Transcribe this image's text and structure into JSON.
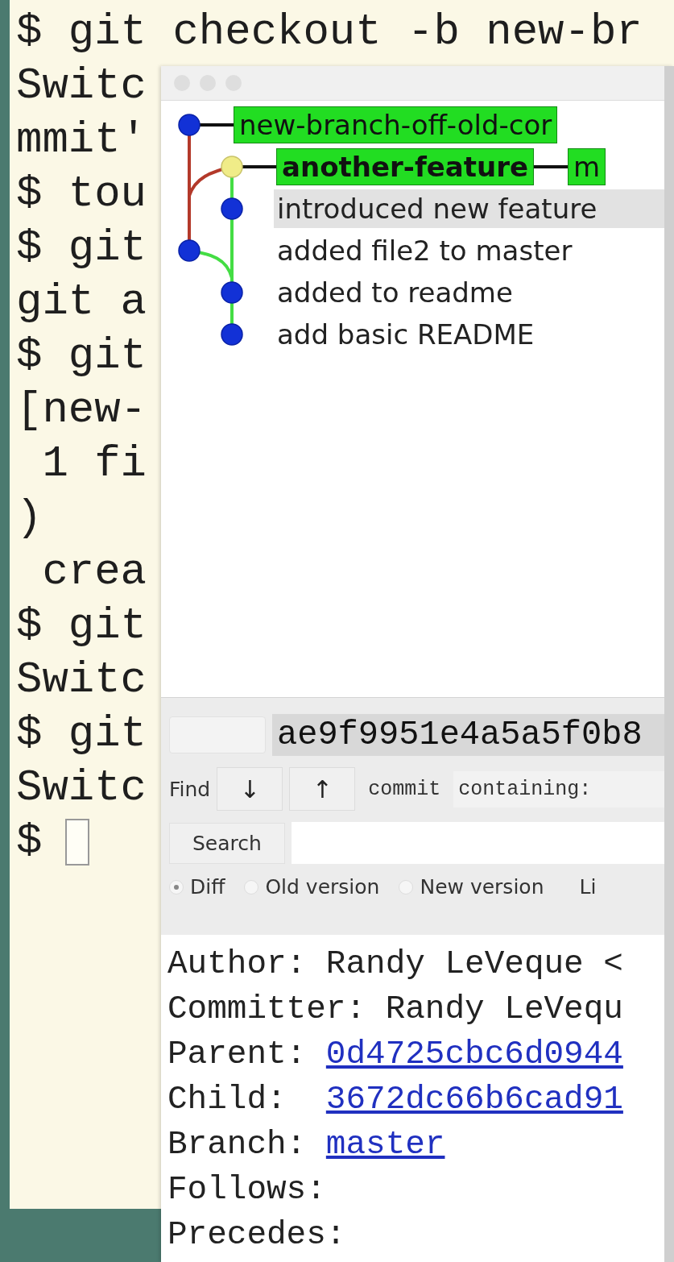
{
  "terminal": {
    "lines": [
      "$ git checkout -b new-br",
      "Switc",
      "mmit'",
      "$ tou",
      "$ git",
      "git a",
      "$ git",
      "[new-",
      " 1 fi",
      ")",
      " crea",
      "$ git",
      "Switc",
      "$ git",
      "Switc",
      "$ "
    ]
  },
  "gitk": {
    "commits": [
      {
        "head": false,
        "selected": false,
        "refs": [
          {
            "name": "new-branch-off-old-cor",
            "current": false
          }
        ]
      },
      {
        "head": true,
        "selected": false,
        "refs": [
          {
            "name": "another-feature",
            "current": true
          },
          {
            "name": "m",
            "current": false
          }
        ]
      },
      {
        "head": false,
        "selected": true,
        "message": "introduced new feature"
      },
      {
        "head": false,
        "selected": false,
        "message": "added file2 to master"
      },
      {
        "head": false,
        "selected": false,
        "message": "added to readme"
      },
      {
        "head": false,
        "selected": false,
        "message": "add basic README"
      }
    ],
    "sha1": "ae9f9951e4a5a5f0b8",
    "find": {
      "label": "Find",
      "down": "↓",
      "up": "↑",
      "type": "commit",
      "mode": "containing:"
    },
    "search_button": "Search",
    "view_options": [
      {
        "label": "Diff",
        "selected": true
      },
      {
        "label": "Old version",
        "selected": false
      },
      {
        "label": "New version",
        "selected": false
      }
    ],
    "context_label": "Li",
    "details": [
      {
        "label": "Author:",
        "value": "Randy LeVeque <",
        "kind": "text"
      },
      {
        "label": "Committer:",
        "value": "Randy LeVequ",
        "kind": "text"
      },
      {
        "label": "Parent:",
        "value": "0d4725cbc6d0944",
        "kind": "link"
      },
      {
        "label": "Child: ",
        "value": "3672dc66b6cad91",
        "kind": "link"
      },
      {
        "label": "Branch:",
        "value": "master",
        "kind": "link"
      },
      {
        "label": "Follows:"
      },
      {
        "label": "Precedes:"
      }
    ]
  }
}
